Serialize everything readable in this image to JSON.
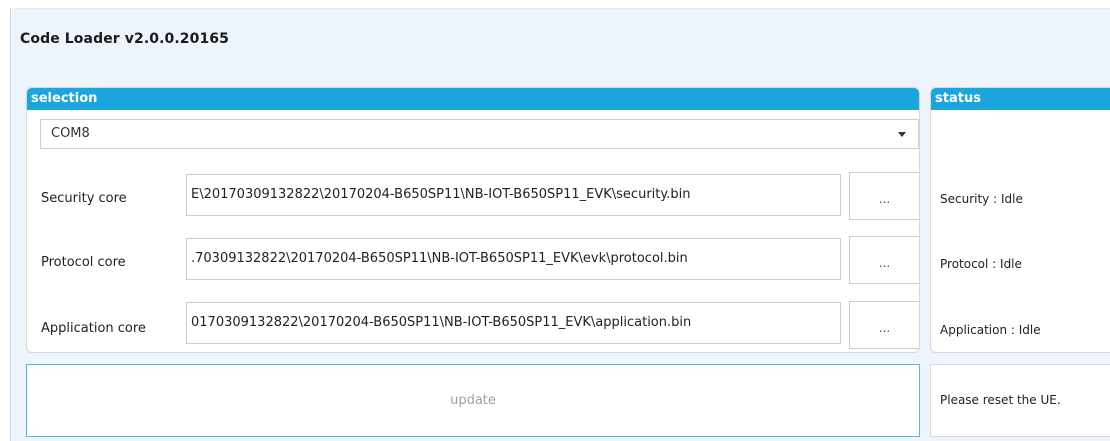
{
  "window": {
    "title": "Code Loader v2.0.0.20165"
  },
  "selection": {
    "header": "selection",
    "port": {
      "value": "COM8"
    },
    "rows": [
      {
        "label": "Security core",
        "path": "E\\20170309132822\\20170204-B650SP11\\NB-IOT-B650SP11_EVK\\security.bin",
        "button": "..."
      },
      {
        "label": "Protocol core",
        "path": ".70309132822\\20170204-B650SP11\\NB-IOT-B650SP11_EVK\\evk\\protocol.bin",
        "button": "..."
      },
      {
        "label": "Application core",
        "path": "0170309132822\\20170204-B650SP11\\NB-IOT-B650SP11_EVK\\application.bin",
        "button": "..."
      }
    ]
  },
  "status": {
    "header": "status",
    "security": "Security :  Idle",
    "protocol": "Protocol :  Idle",
    "application": "Application :  Idle",
    "message": "Please reset the UE."
  },
  "actions": {
    "update_label": "update"
  }
}
